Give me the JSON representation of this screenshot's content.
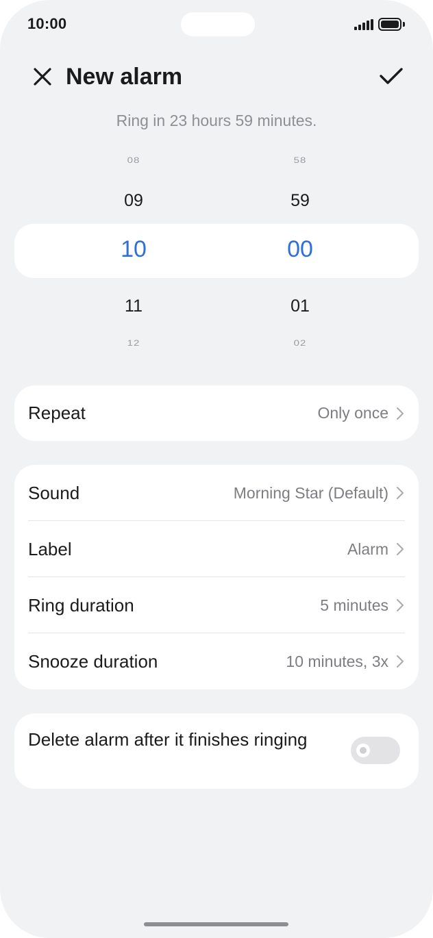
{
  "status_bar": {
    "time": "10:00",
    "icons": [
      "signal-icon",
      "battery-icon"
    ]
  },
  "header": {
    "title": "New alarm",
    "close_icon": "close-icon",
    "confirm_icon": "checkmark-icon",
    "subtitle": "Ring in 23 hours 59 minutes."
  },
  "picker": {
    "hours": {
      "far_above": "08",
      "above": "09",
      "selected": "10",
      "below": "11",
      "far_below": "12"
    },
    "minutes": {
      "far_above": "58",
      "above": "59",
      "selected": "00",
      "below": "01",
      "far_below": "02"
    },
    "selected_color": "#2f6fdb"
  },
  "repeat": {
    "label": "Repeat",
    "value": "Only once"
  },
  "settings": [
    {
      "label": "Sound",
      "value": "Morning Star (Default)"
    },
    {
      "label": "Label",
      "value": "Alarm"
    },
    {
      "label": "Ring duration",
      "value": "5 minutes"
    },
    {
      "label": "Snooze duration",
      "value": "10 minutes, 3x"
    }
  ],
  "delete_after": {
    "label": "Delete alarm after it finishes ringing",
    "enabled": false
  },
  "colors": {
    "background": "#f1f2f4",
    "card": "#ffffff",
    "accent": "#2f6fdb"
  }
}
